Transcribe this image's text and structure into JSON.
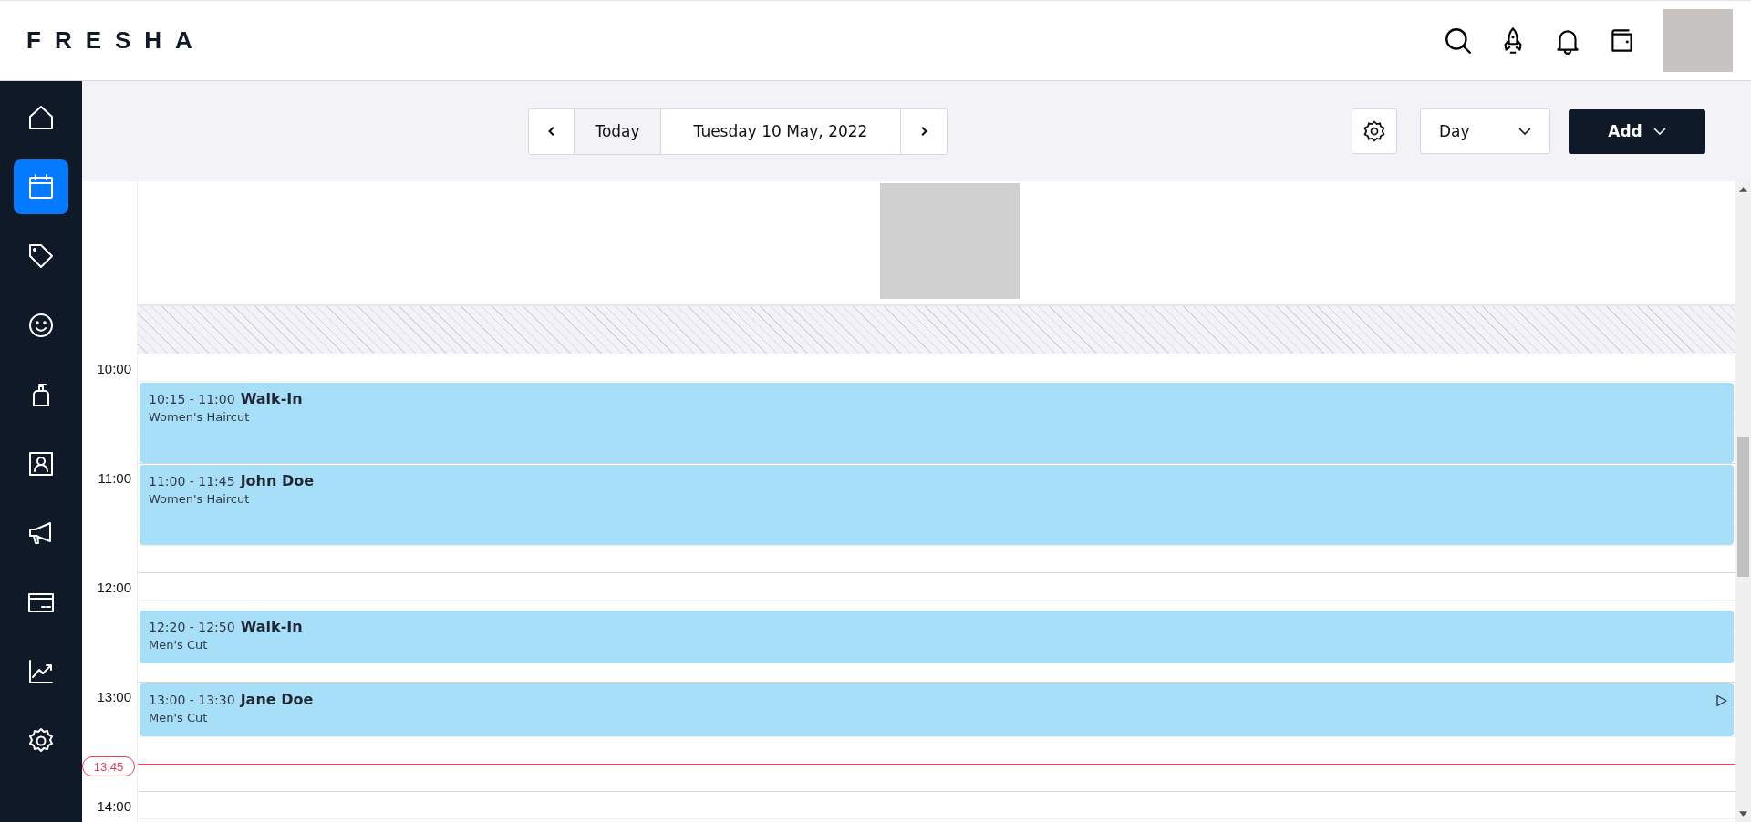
{
  "header": {
    "logo": "FRESHA"
  },
  "sidebar": {
    "items": [
      {
        "selected": false
      },
      {
        "selected": true
      },
      {
        "selected": false
      },
      {
        "selected": false
      },
      {
        "selected": false
      },
      {
        "selected": false
      },
      {
        "selected": false
      },
      {
        "selected": false
      },
      {
        "selected": false
      },
      {
        "selected": false
      }
    ]
  },
  "toolbar": {
    "today": "Today",
    "date": "Tuesday 10 May, 2022",
    "view": "Day",
    "add": "Add"
  },
  "calendar": {
    "hours": [
      "10:00",
      "11:00",
      "12:00",
      "13:00",
      "14:00"
    ],
    "now": "13:45",
    "appointments": [
      {
        "time": "10:15 - 11:00",
        "client": "Walk-In",
        "service": "Women's Haircut",
        "started": false
      },
      {
        "time": "11:00 - 11:45",
        "client": "John Doe",
        "service": "Women's Haircut",
        "started": false
      },
      {
        "time": "12:20 - 12:50",
        "client": "Walk-In",
        "service": "Men's Cut",
        "started": false
      },
      {
        "time": "13:00 - 13:30",
        "client": "Jane Doe",
        "service": "Men's Cut",
        "started": true
      }
    ]
  }
}
